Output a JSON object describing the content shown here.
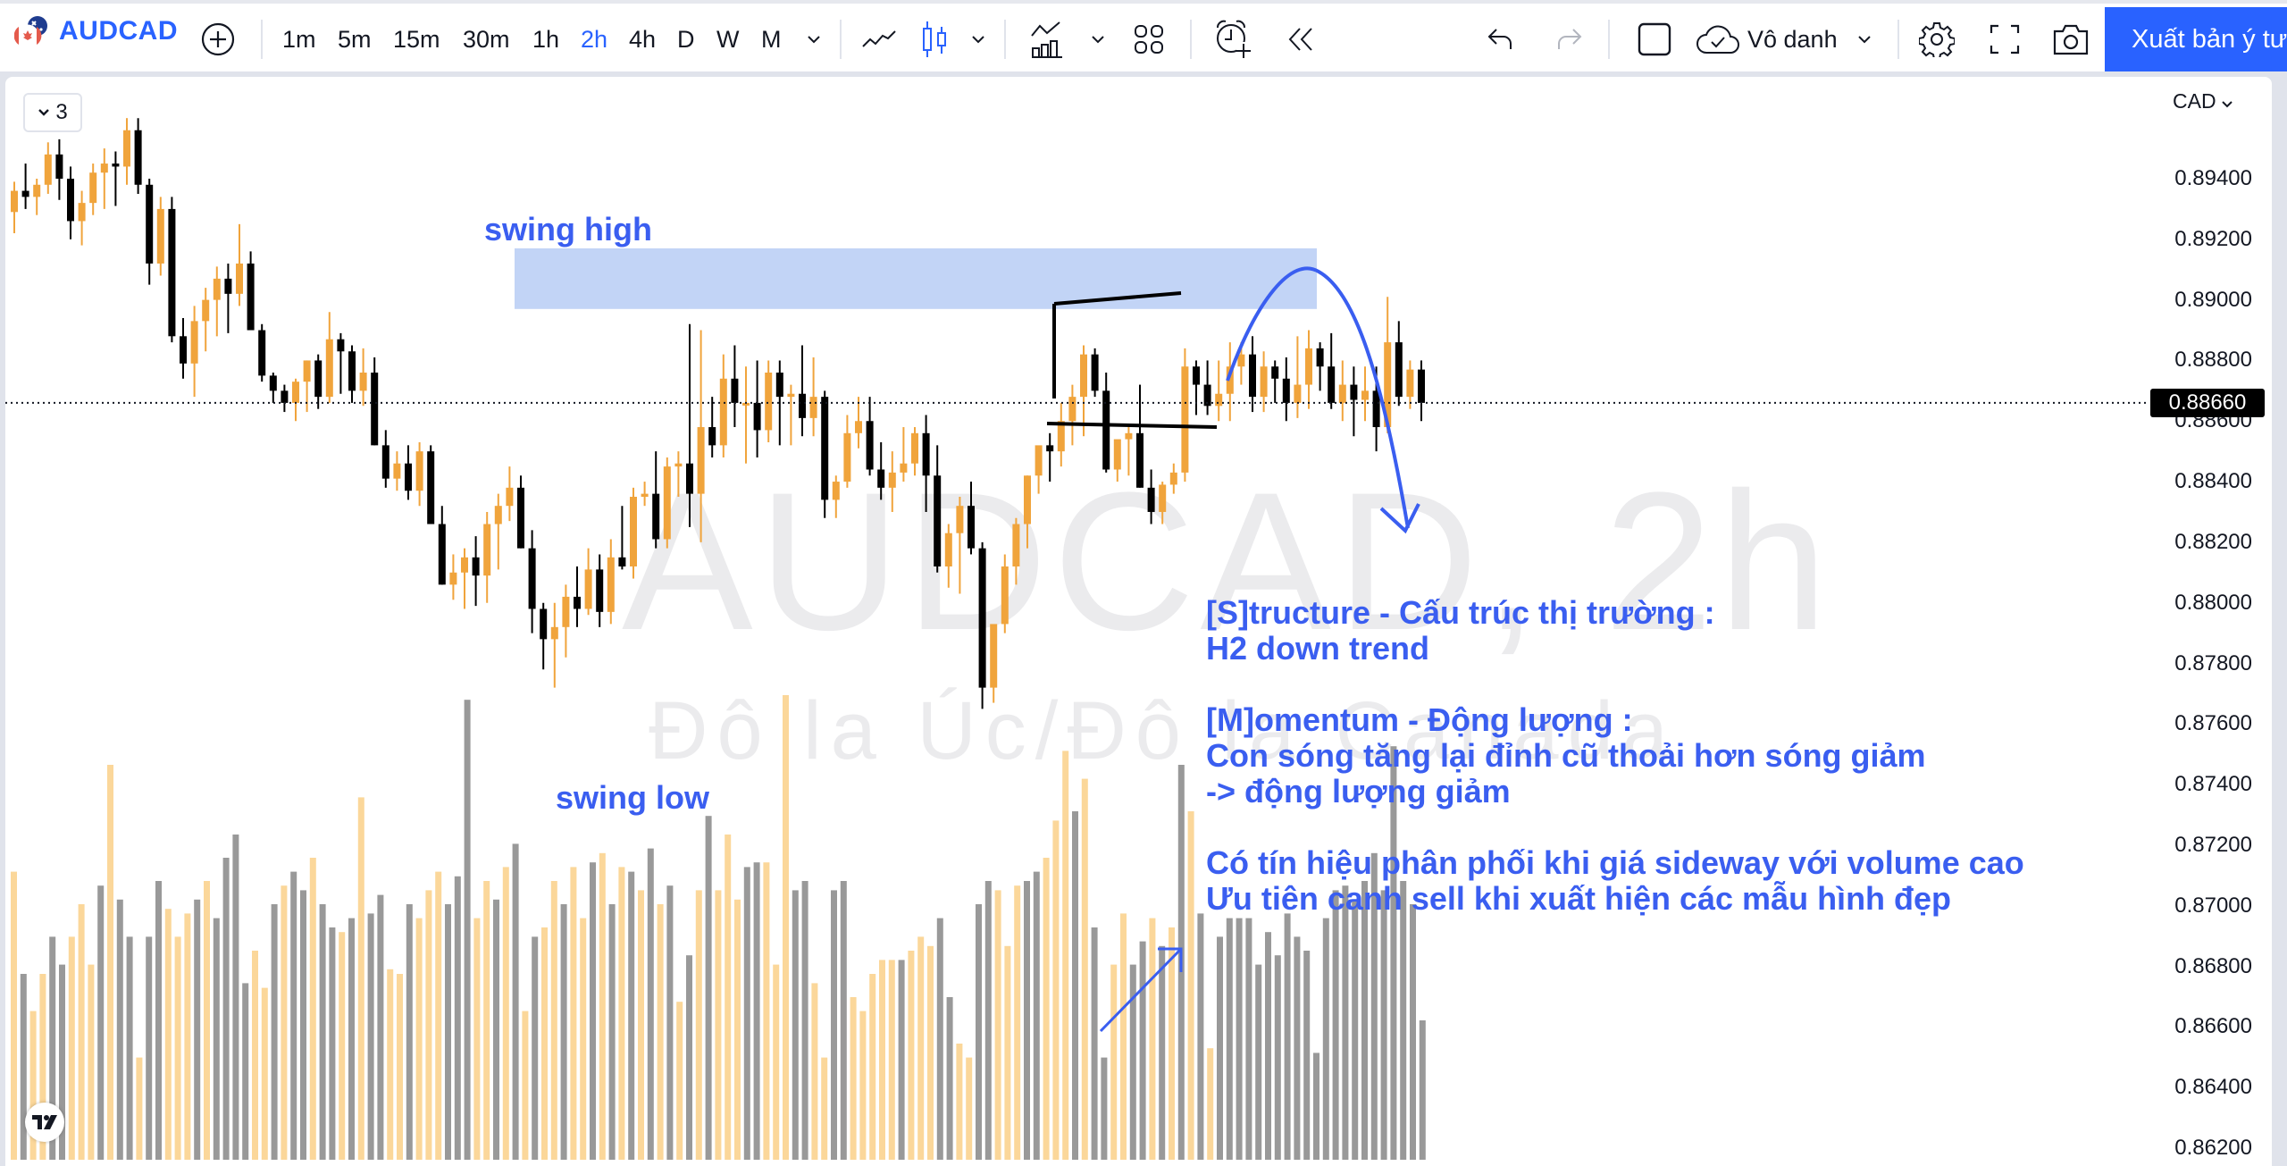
{
  "toolbar": {
    "symbol": "AUDCAD",
    "timeframes": [
      "1m",
      "5m",
      "15m",
      "30m",
      "1h",
      "2h",
      "4h",
      "D",
      "W",
      "M"
    ],
    "active_timeframe": "2h",
    "layout_name": "Vô danh",
    "publish_label": "Xuất bản ý tưởng",
    "icons": [
      "flag-icon",
      "add-symbol-icon",
      "chevron-down-icon",
      "line-chart-icon",
      "candles-icon",
      "chevron-down-icon",
      "indicators-icon",
      "chevron-down-icon",
      "layout-grid-icon",
      "alert-icon",
      "replay-icon",
      "undo-icon",
      "redo-icon",
      "square-icon",
      "cloud-save-icon",
      "chevron-down-icon",
      "gear-icon",
      "fullscreen-icon",
      "camera-icon"
    ]
  },
  "chart": {
    "legend_count": "3",
    "watermark_symbol": "AUDCAD, 2h",
    "watermark_description": "Đô la Úc/Đô la Canada",
    "currency_label": "CAD",
    "current_price": "0.88660",
    "annotations": {
      "swing_high": "swing high",
      "swing_low": "swing low",
      "notes": "[S]tructure - Cấu trúc thị trường :\nH2 down trend\n\n[M]omentum - Động lượng :\nCon sóng tăng lại đỉnh cũ thoải hơn sóng giảm\n-> động lượng giảm\n\nCó tín hiệu phân phối khi giá sideway với volume cao\nƯu tiên canh sell khi xuất hiện các mẫu hình đẹp"
    },
    "colors": {
      "up": "#f0a43c",
      "down": "#000000",
      "vol_up": "#fbd79a",
      "vol_down": "#999999",
      "annotation": "#3a5ef0",
      "zone": "#c2d4f6"
    }
  },
  "chart_data": {
    "type": "candlestick",
    "title": "AUDCAD, 2h",
    "ylabel": "CAD",
    "ylim": [
      0.8615,
      0.8955
    ],
    "y_ticks": [
      "0.89400",
      "0.89200",
      "0.89000",
      "0.88800",
      "0.88600",
      "0.88400",
      "0.88200",
      "0.88000",
      "0.87800",
      "0.87600",
      "0.87400",
      "0.87200",
      "0.87000",
      "0.86800",
      "0.86600",
      "0.86400",
      "0.86200"
    ],
    "last_price": 0.8866,
    "supply_zone": [
      0.8897,
      0.8917
    ],
    "ohlc": [
      [
        0.8929,
        0.8939,
        0.8922,
        0.8936
      ],
      [
        0.8936,
        0.8945,
        0.893,
        0.8934
      ],
      [
        0.8934,
        0.894,
        0.8928,
        0.8938
      ],
      [
        0.8938,
        0.8952,
        0.8935,
        0.8948
      ],
      [
        0.8948,
        0.8953,
        0.8933,
        0.894
      ],
      [
        0.894,
        0.8944,
        0.892,
        0.8926
      ],
      [
        0.8926,
        0.8936,
        0.8918,
        0.8932
      ],
      [
        0.8932,
        0.8945,
        0.8928,
        0.8942
      ],
      [
        0.8942,
        0.895,
        0.893,
        0.8945
      ],
      [
        0.8945,
        0.8949,
        0.8931,
        0.8944
      ],
      [
        0.8944,
        0.896,
        0.8938,
        0.8956
      ],
      [
        0.8956,
        0.896,
        0.8935,
        0.8938
      ],
      [
        0.8938,
        0.894,
        0.8905,
        0.8912
      ],
      [
        0.8912,
        0.8934,
        0.8908,
        0.893
      ],
      [
        0.893,
        0.8934,
        0.8886,
        0.8888
      ],
      [
        0.8888,
        0.8894,
        0.8874,
        0.8879
      ],
      [
        0.8879,
        0.8898,
        0.8868,
        0.8893
      ],
      [
        0.8893,
        0.8904,
        0.8883,
        0.89
      ],
      [
        0.89,
        0.8911,
        0.8888,
        0.8907
      ],
      [
        0.8907,
        0.8912,
        0.8889,
        0.8902
      ],
      [
        0.8902,
        0.8925,
        0.8898,
        0.8912
      ],
      [
        0.8912,
        0.8916,
        0.8895,
        0.889
      ],
      [
        0.889,
        0.8892,
        0.8873,
        0.8875
      ],
      [
        0.8875,
        0.8876,
        0.8866,
        0.887
      ],
      [
        0.887,
        0.8872,
        0.8863,
        0.8866
      ],
      [
        0.8866,
        0.8874,
        0.886,
        0.8873
      ],
      [
        0.8873,
        0.888,
        0.8863,
        0.888
      ],
      [
        0.888,
        0.8882,
        0.8864,
        0.8868
      ],
      [
        0.8868,
        0.8896,
        0.8866,
        0.8887
      ],
      [
        0.8887,
        0.8889,
        0.8869,
        0.8883
      ],
      [
        0.8883,
        0.8885,
        0.8866,
        0.887
      ],
      [
        0.887,
        0.8884,
        0.8865,
        0.8876
      ],
      [
        0.8876,
        0.8881,
        0.8852,
        0.8852
      ],
      [
        0.8852,
        0.8857,
        0.8838,
        0.8841
      ],
      [
        0.8841,
        0.885,
        0.8837,
        0.8846
      ],
      [
        0.8846,
        0.8852,
        0.8834,
        0.8837
      ],
      [
        0.8837,
        0.8853,
        0.8832,
        0.885
      ],
      [
        0.885,
        0.8852,
        0.8826,
        0.8826
      ],
      [
        0.8826,
        0.8832,
        0.8806,
        0.8806
      ],
      [
        0.8806,
        0.8816,
        0.8801,
        0.881
      ],
      [
        0.881,
        0.8818,
        0.8798,
        0.8815
      ],
      [
        0.8815,
        0.8822,
        0.8799,
        0.8809
      ],
      [
        0.8809,
        0.883,
        0.88,
        0.8826
      ],
      [
        0.8826,
        0.8836,
        0.8811,
        0.8832
      ],
      [
        0.8832,
        0.8845,
        0.8827,
        0.8838
      ],
      [
        0.8838,
        0.8842,
        0.8818,
        0.8818
      ],
      [
        0.8818,
        0.8824,
        0.879,
        0.8798
      ],
      [
        0.8798,
        0.88,
        0.8778,
        0.8788
      ],
      [
        0.8788,
        0.88,
        0.8772,
        0.8792
      ],
      [
        0.8792,
        0.8806,
        0.8782,
        0.8802
      ],
      [
        0.8802,
        0.8812,
        0.8792,
        0.8798
      ],
      [
        0.8798,
        0.8818,
        0.8796,
        0.8811
      ],
      [
        0.8811,
        0.8816,
        0.8792,
        0.8797
      ],
      [
        0.8797,
        0.8821,
        0.8793,
        0.8815
      ],
      [
        0.8815,
        0.8832,
        0.8811,
        0.8812
      ],
      [
        0.8812,
        0.8838,
        0.8808,
        0.8835
      ],
      [
        0.8835,
        0.884,
        0.8832,
        0.8836
      ],
      [
        0.8836,
        0.885,
        0.8818,
        0.8821
      ],
      [
        0.8821,
        0.8848,
        0.8818,
        0.8845
      ],
      [
        0.8845,
        0.885,
        0.8835,
        0.8846
      ],
      [
        0.8846,
        0.8892,
        0.8825,
        0.8836
      ],
      [
        0.8836,
        0.889,
        0.882,
        0.8858
      ],
      [
        0.8858,
        0.8868,
        0.8848,
        0.8852
      ],
      [
        0.8852,
        0.8882,
        0.8848,
        0.8874
      ],
      [
        0.8874,
        0.8885,
        0.8858,
        0.8866
      ],
      [
        0.8866,
        0.8878,
        0.8846,
        0.8866
      ],
      [
        0.8866,
        0.888,
        0.8848,
        0.8857
      ],
      [
        0.8857,
        0.888,
        0.8853,
        0.8876
      ],
      [
        0.8876,
        0.888,
        0.8852,
        0.8868
      ],
      [
        0.8868,
        0.8872,
        0.8852,
        0.8869
      ],
      [
        0.8869,
        0.8885,
        0.8855,
        0.8861
      ],
      [
        0.8861,
        0.8881,
        0.8855,
        0.8868
      ],
      [
        0.8868,
        0.887,
        0.8828,
        0.8834
      ],
      [
        0.8834,
        0.8842,
        0.8828,
        0.884
      ],
      [
        0.884,
        0.8862,
        0.8838,
        0.8856
      ],
      [
        0.8856,
        0.8868,
        0.8851,
        0.886
      ],
      [
        0.886,
        0.8868,
        0.8842,
        0.8844
      ],
      [
        0.8844,
        0.8853,
        0.8834,
        0.8838
      ],
      [
        0.8838,
        0.885,
        0.883,
        0.8843
      ],
      [
        0.8843,
        0.8858,
        0.884,
        0.8846
      ],
      [
        0.8846,
        0.8858,
        0.8842,
        0.8856
      ],
      [
        0.8856,
        0.8862,
        0.883,
        0.8842
      ],
      [
        0.8842,
        0.8852,
        0.881,
        0.8812
      ],
      [
        0.8812,
        0.8826,
        0.8805,
        0.8823
      ],
      [
        0.8823,
        0.8835,
        0.8803,
        0.8832
      ],
      [
        0.8832,
        0.884,
        0.8816,
        0.8818
      ],
      [
        0.8818,
        0.882,
        0.8765,
        0.8772
      ],
      [
        0.8772,
        0.8782,
        0.8767,
        0.8793
      ],
      [
        0.8793,
        0.8816,
        0.879,
        0.8812
      ],
      [
        0.8812,
        0.8828,
        0.8806,
        0.8826
      ],
      [
        0.8826,
        0.8842,
        0.8818,
        0.8842
      ],
      [
        0.8842,
        0.8848,
        0.8836,
        0.8852
      ],
      [
        0.8852,
        0.8856,
        0.884,
        0.885
      ],
      [
        0.885,
        0.8866,
        0.8845,
        0.886
      ],
      [
        0.886,
        0.8872,
        0.8852,
        0.8868
      ],
      [
        0.8868,
        0.8885,
        0.8855,
        0.8882
      ],
      [
        0.8882,
        0.8884,
        0.8868,
        0.887
      ],
      [
        0.887,
        0.8876,
        0.8843,
        0.8844
      ],
      [
        0.8844,
        0.885,
        0.884,
        0.8854
      ],
      [
        0.8854,
        0.8858,
        0.8842,
        0.8856
      ],
      [
        0.8856,
        0.8872,
        0.8838,
        0.8838
      ],
      [
        0.8838,
        0.8844,
        0.8826,
        0.883
      ],
      [
        0.883,
        0.884,
        0.8826,
        0.8839
      ],
      [
        0.8839,
        0.8846,
        0.8836,
        0.8843
      ],
      [
        0.8843,
        0.8884,
        0.884,
        0.8878
      ],
      [
        0.8878,
        0.888,
        0.8862,
        0.8872
      ],
      [
        0.8872,
        0.888,
        0.8862,
        0.8865
      ],
      [
        0.8865,
        0.888,
        0.886,
        0.8869
      ],
      [
        0.8869,
        0.8886,
        0.886,
        0.8878
      ],
      [
        0.8878,
        0.8886,
        0.8872,
        0.8882
      ],
      [
        0.8882,
        0.8888,
        0.8863,
        0.8868
      ],
      [
        0.8868,
        0.8883,
        0.8863,
        0.8878
      ],
      [
        0.8878,
        0.888,
        0.8866,
        0.8874
      ],
      [
        0.8874,
        0.8881,
        0.886,
        0.8866
      ],
      [
        0.8866,
        0.8888,
        0.8861,
        0.8872
      ],
      [
        0.8872,
        0.889,
        0.8864,
        0.8884
      ],
      [
        0.8884,
        0.8886,
        0.887,
        0.8878
      ],
      [
        0.8878,
        0.8889,
        0.8864,
        0.8866
      ],
      [
        0.8866,
        0.888,
        0.886,
        0.8872
      ],
      [
        0.8872,
        0.8878,
        0.8855,
        0.8867
      ],
      [
        0.8867,
        0.8878,
        0.886,
        0.887
      ],
      [
        0.887,
        0.8878,
        0.885,
        0.8858
      ],
      [
        0.8858,
        0.8901,
        0.8856,
        0.8886
      ],
      [
        0.8886,
        0.8893,
        0.8865,
        0.8868
      ],
      [
        0.8868,
        0.888,
        0.8864,
        0.8877
      ],
      [
        0.8877,
        0.888,
        0.886,
        0.8866
      ]
    ],
    "volume": [
      62,
      40,
      32,
      40,
      48,
      42,
      48,
      55,
      42,
      59,
      85,
      56,
      48,
      22,
      48,
      60,
      54,
      48,
      53,
      56,
      60,
      52,
      65,
      70,
      38,
      45,
      37,
      55,
      59,
      62,
      58,
      65,
      55,
      50,
      49,
      52,
      78,
      53,
      57,
      41,
      40,
      55,
      52,
      58,
      62,
      55,
      61,
      99,
      52,
      60,
      56,
      63,
      68,
      32,
      48,
      50,
      60,
      55,
      63,
      52,
      64,
      66,
      55,
      63,
      62,
      58,
      67,
      55,
      59,
      34,
      44,
      58,
      74,
      58,
      70,
      56,
      63,
      64,
      64,
      42,
      100,
      58,
      60,
      38,
      22,
      58,
      60,
      35,
      32,
      40,
      43,
      43,
      43,
      45,
      48,
      46,
      52,
      35,
      25,
      22,
      55,
      60,
      58,
      46,
      59,
      60,
      62,
      65,
      73,
      88,
      75,
      82,
      50,
      22,
      42,
      53,
      42,
      47,
      52,
      46,
      50,
      85,
      75,
      53,
      24,
      48,
      52,
      52,
      52,
      42,
      49,
      44,
      53,
      48,
      45,
      23,
      52,
      58,
      59,
      56,
      60,
      66,
      58,
      89,
      60,
      55,
      30
    ],
    "volume_direction": "up/down matches candle color"
  }
}
